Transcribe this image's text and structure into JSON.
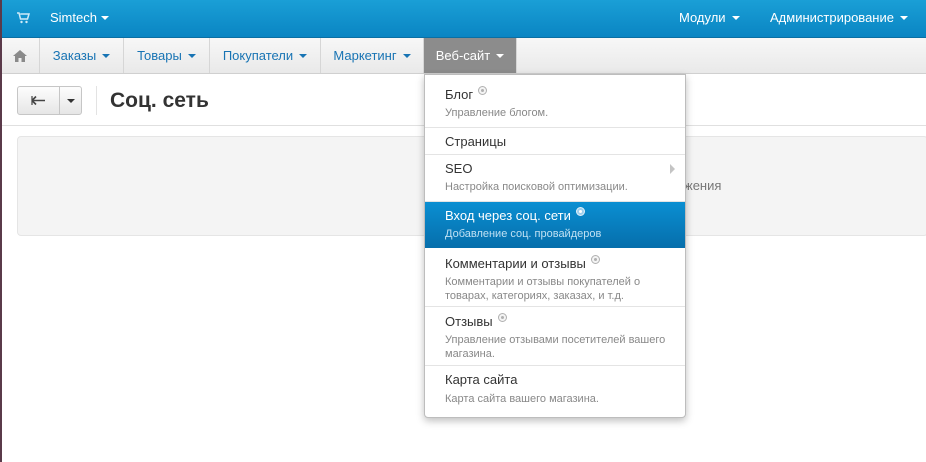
{
  "topbar": {
    "brand": "Simtech",
    "modules": "Модули",
    "admin": "Администрирование"
  },
  "nav": {
    "items": [
      {
        "label": "Заказы"
      },
      {
        "label": "Товары"
      },
      {
        "label": "Покупатели"
      },
      {
        "label": "Маркетинг"
      },
      {
        "label": "Веб-сайт"
      }
    ]
  },
  "page": {
    "title": "Соц. сеть",
    "panel_text": "жения"
  },
  "menu": {
    "items": [
      {
        "title": "Блог",
        "desc": "Управление блогом."
      },
      {
        "title": "Страницы",
        "desc": ""
      },
      {
        "title": "SEO",
        "desc": "Настройка поисковой оптимизации."
      },
      {
        "title": "Вход через соц. сети",
        "desc": "Добавление соц. провайдеров"
      },
      {
        "title": "Комментарии и отзывы",
        "desc": "Комментарии и отзывы покупателей о товарах, категориях, заказах, и т.д."
      },
      {
        "title": "Отзывы",
        "desc": "Управление отзывами посетителей вашего магазина."
      },
      {
        "title": "Карта сайта",
        "desc": "Карта сайта вашего магазина."
      }
    ]
  },
  "icons": {
    "cart": "cart-icon",
    "home": "home-icon",
    "back": "back-arrow-icon",
    "addon_badge": "addon-badge-icon",
    "submenu": "chevron-right-icon"
  },
  "colors": {
    "topbar": "#0a85c3",
    "link": "#1874b4",
    "active_nav": "#8c8c8c",
    "highlight": "#0a8fd2"
  }
}
